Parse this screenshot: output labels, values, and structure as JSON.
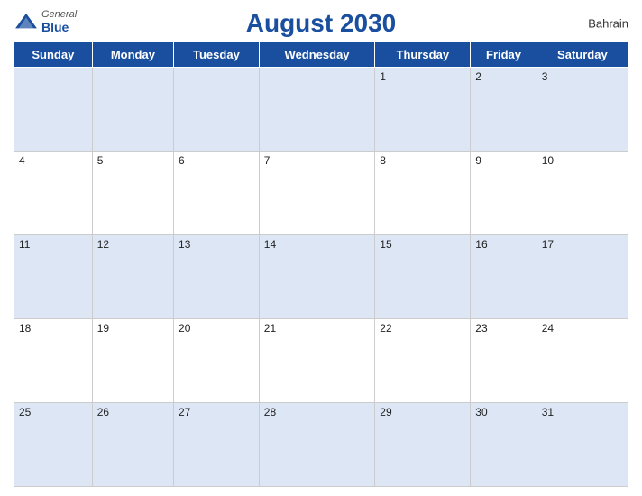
{
  "header": {
    "title": "August 2030",
    "country": "Bahrain",
    "logo_general": "General",
    "logo_blue": "Blue"
  },
  "weekdays": [
    "Sunday",
    "Monday",
    "Tuesday",
    "Wednesday",
    "Thursday",
    "Friday",
    "Saturday"
  ],
  "weeks": [
    [
      "",
      "",
      "",
      "",
      "1",
      "2",
      "3"
    ],
    [
      "4",
      "5",
      "6",
      "7",
      "8",
      "9",
      "10"
    ],
    [
      "11",
      "12",
      "13",
      "14",
      "15",
      "16",
      "17"
    ],
    [
      "18",
      "19",
      "20",
      "21",
      "22",
      "23",
      "24"
    ],
    [
      "25",
      "26",
      "27",
      "28",
      "29",
      "30",
      "31"
    ]
  ]
}
